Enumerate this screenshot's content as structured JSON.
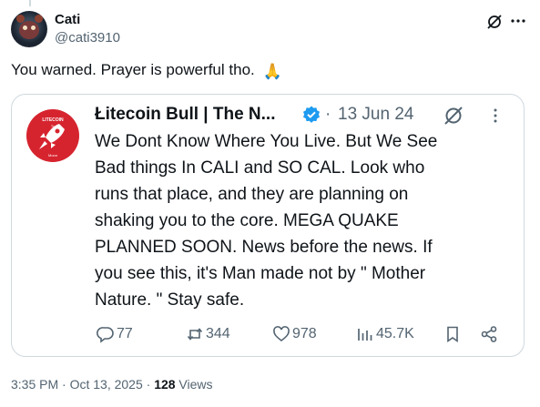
{
  "post": {
    "author_name": "Cati",
    "author_handle": "@cati3910",
    "text": "You warned.  Prayer is powerful tho.",
    "emoji": "🙏",
    "timestamp": "3:35 PM · Oct 13, 2025 · ",
    "views_count": "128",
    "views_label": " Views"
  },
  "quote": {
    "avatar_text_top": "LITECOIN",
    "avatar_text_mid": "To",
    "avatar_text_bottom": "Moon",
    "author_name": "Łitecoin Bull | The N...",
    "separator": "·",
    "date": "13 Jun 24",
    "lines": [
      "We Dont Know Where You Live. But We See",
      "Bad things In CALI and SO CAL. Look who",
      "runs that place, and they are planning on",
      "shaking you to the core. MEGA QUAKE",
      "PLANNED SOON. News before the news. If",
      "you see this, it's Man made not by \" Mother",
      "Nature. \" Stay safe."
    ],
    "replies": "77",
    "reposts": "344",
    "likes": "978",
    "views": "45.7K"
  },
  "colors": {
    "text_primary": "#0f1419",
    "text_secondary": "#536471",
    "border": "#cfd9de",
    "verified": "#1d9bf0",
    "avatar_red": "#d6242f"
  },
  "icons": [
    "grok-icon",
    "more-icon",
    "verified-icon",
    "reply-icon",
    "repost-icon",
    "like-icon",
    "views-icon",
    "bookmark-icon",
    "share-icon",
    "rocket-icon"
  ]
}
